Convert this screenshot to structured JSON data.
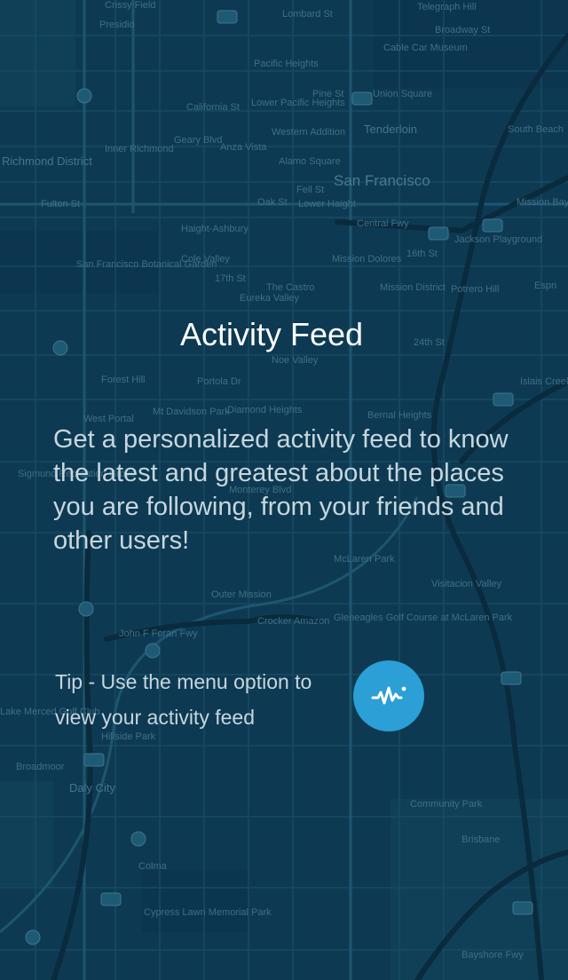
{
  "onboarding": {
    "title": "Activity Feed",
    "description": "Get a personalized activity feed to know the latest and greatest about the places you are following, from your friends and other users!",
    "tip": "Tip - Use the menu option to view your activity feed",
    "tip_icon": "activity-pulse-icon",
    "accent_color": "#2b9fd6",
    "background_color": "#0d3a52"
  },
  "map_labels": {
    "l1": "Crissy Field",
    "l2": "Presidio",
    "l3": "Lombard St",
    "l4": "Telegraph Hill",
    "l5": "Broadway St",
    "l6": "Cable Car Museum",
    "l7": "Pacific Heights",
    "l8": "Union Square",
    "l9": "California St",
    "l10": "Lower Pacific Heights",
    "l11": "Pine St",
    "l12": "Tenderloin",
    "l13": "Richmond District",
    "l14": "Inner Richmond",
    "l15": "Western Addition",
    "l16": "Alamo Square",
    "l17": "San Francisco",
    "l18": "Geary Blvd",
    "l19": "Anza Vista",
    "l20": "Fulton St",
    "l21": "Fell St",
    "l22": "Oak St",
    "l23": "Lower Haight",
    "l24": "Central Fwy",
    "l25": "Haight-Ashbury",
    "l26": "Cole Valley",
    "l27": "San Francisco Botanical Garden",
    "l28": "16th St",
    "l29": "Jackson Playground",
    "l30": "Mission Dolores",
    "l31": "Mission District",
    "l32": "Potrero Hill",
    "l33": "The Castro",
    "l34": "Eureka Valley",
    "l35": "17th St",
    "l36": "24th St",
    "l37": "Noe Valley",
    "l38": "Forest Hill",
    "l39": "Portola Dr",
    "l40": "Mt Davidson Park",
    "l41": "Diamond Heights",
    "l42": "West Portal",
    "l43": "Bernal Heights",
    "l44": "Sigmund Recreation Grove",
    "l45": "Monterey Blvd",
    "l46": "McLaren Park",
    "l47": "Outer Mission",
    "l48": "Crocker Amazon",
    "l49": "Gleneagles Golf Course at McLaren Park",
    "l50": "Visitacion Valley",
    "l51": "John F Foran Fwy",
    "l52": "Lake Merced Golf Club",
    "l53": "Hillside Park",
    "l54": "Broadmoor",
    "l55": "Daly City",
    "l56": "Community Park",
    "l57": "Brisbane",
    "l58": "Colma",
    "l59": "Cypress Lawn Memorial Park",
    "l60": "Bayshore Fwy",
    "l61": "Espn",
    "l62": "Islais Creek",
    "l63": "Mission Bay",
    "l64": "South Beach"
  }
}
